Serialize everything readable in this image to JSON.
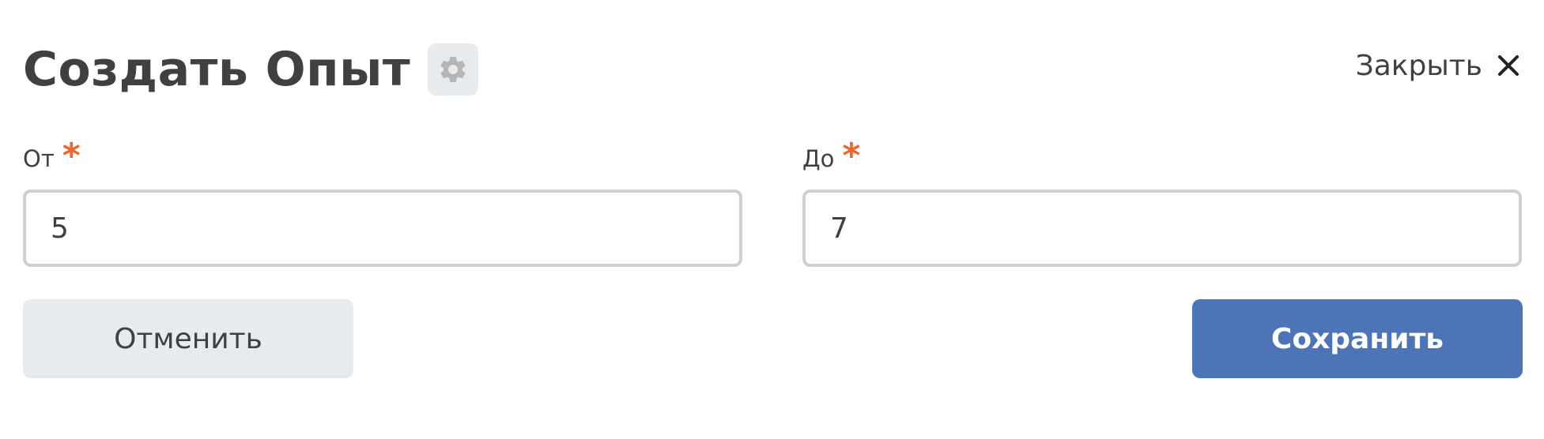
{
  "dialog": {
    "title": "Создать Опыт",
    "settings_icon": "gear-icon",
    "close_label": "Закрыть",
    "close_icon": "close-icon"
  },
  "form": {
    "from": {
      "label": "От",
      "required_mark": "*",
      "value": "5"
    },
    "to": {
      "label": "До",
      "required_mark": "*",
      "value": "7"
    }
  },
  "actions": {
    "cancel_label": "Отменить",
    "save_label": "Сохранить"
  },
  "colors": {
    "text": "#404040",
    "required": "#f2642c",
    "primary": "#4c74b7",
    "secondary_bg": "#e7ebee",
    "input_border": "#cfcfcf",
    "gear": "#b5b5b5"
  }
}
